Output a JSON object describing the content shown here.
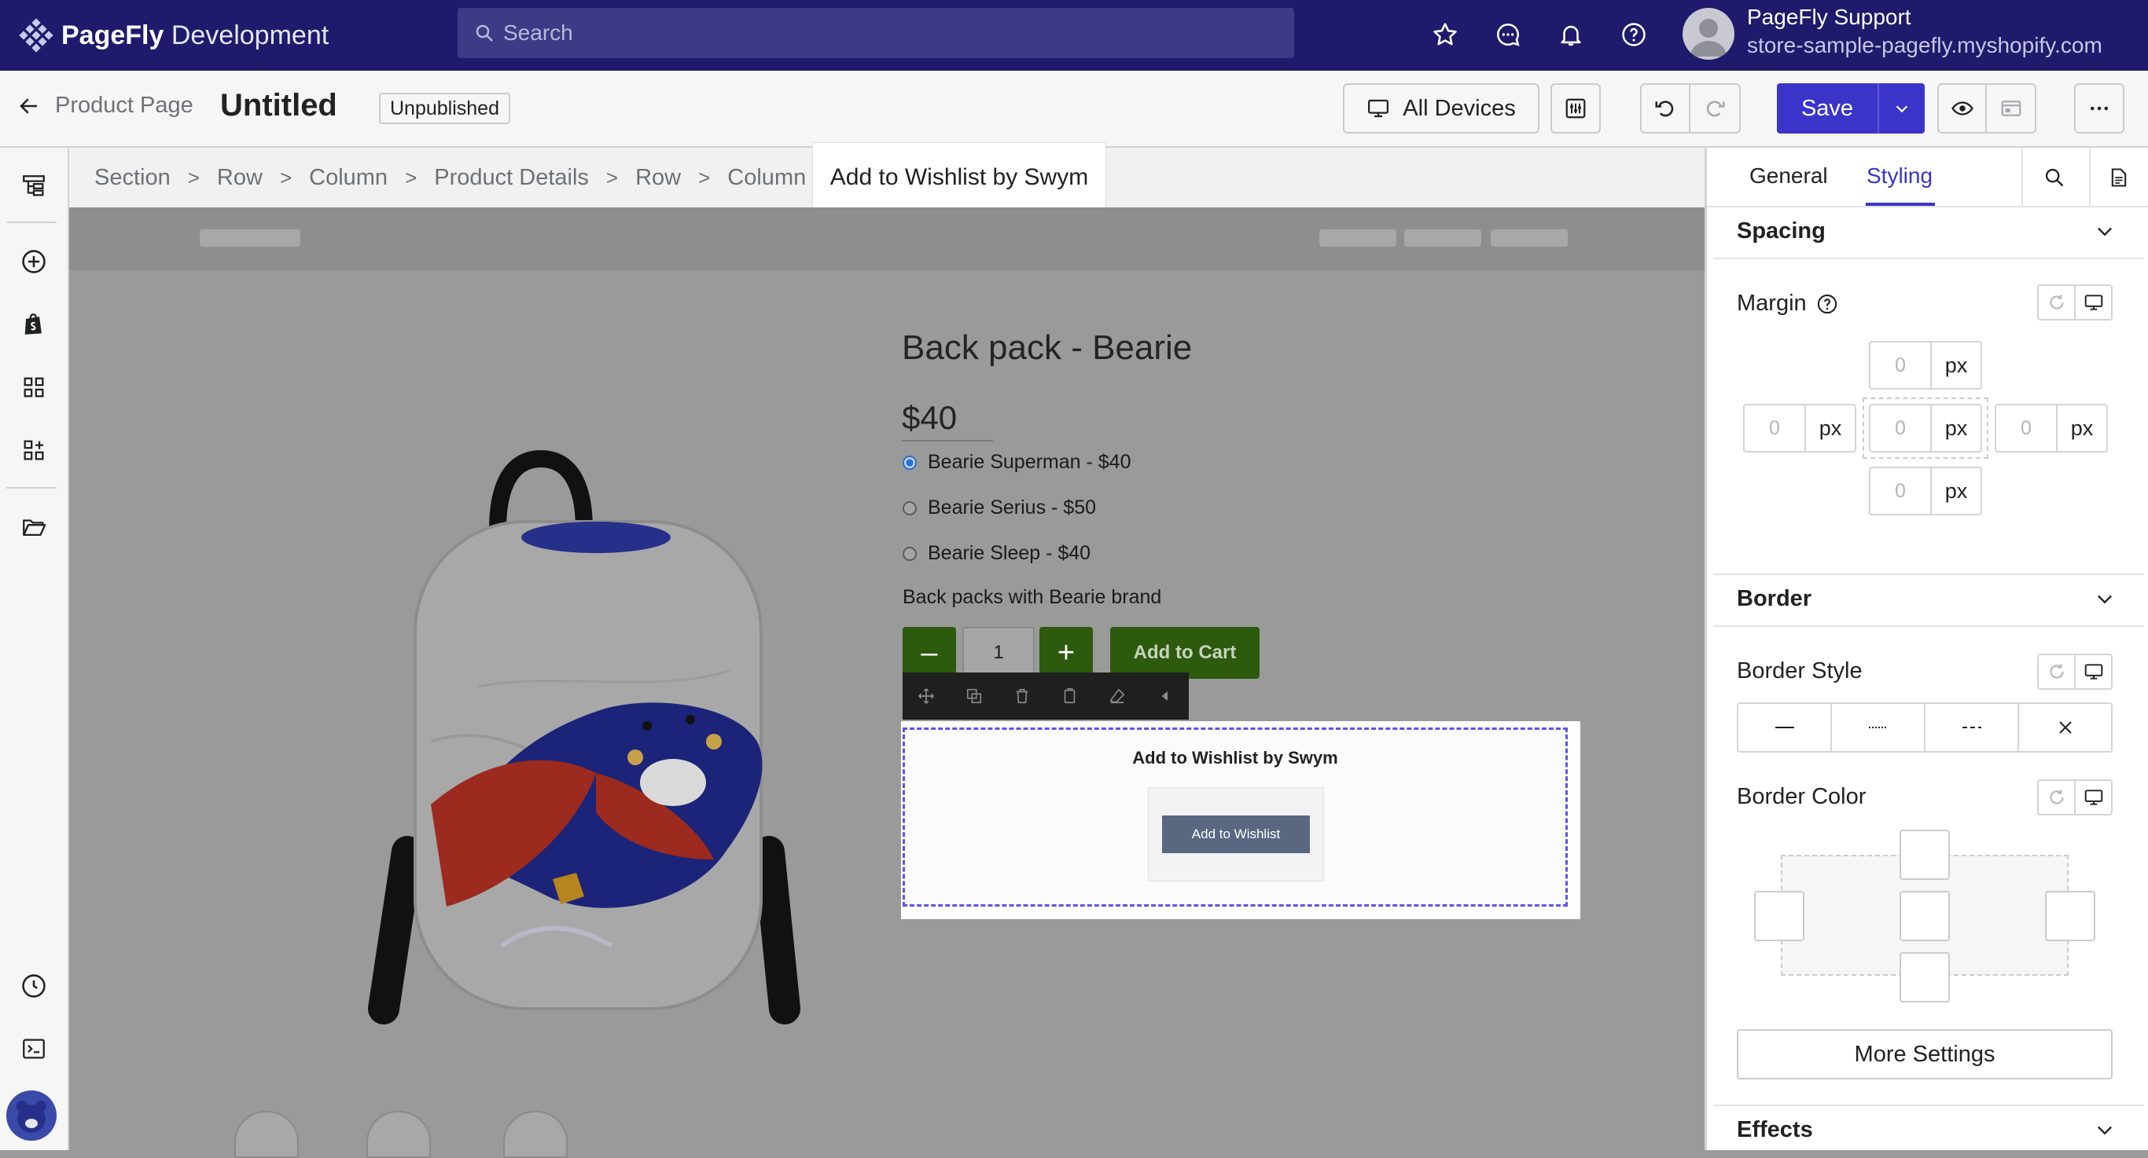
{
  "app": {
    "brand_bold": "PageFly",
    "brand_rest": "Development"
  },
  "search": {
    "placeholder": "Search"
  },
  "user": {
    "name": "PageFly Support",
    "store": "store-sample-pagefly.myshopify.com"
  },
  "header": {
    "back_label": "Product Page",
    "page_title": "Untitled",
    "status_badge": "Unpublished",
    "devices_label": "All Devices",
    "save_label": "Save"
  },
  "breadcrumb": {
    "items": [
      "Section",
      "Row",
      "Column",
      "Product Details",
      "Row",
      "Column"
    ],
    "active": "Add to Wishlist by Swym"
  },
  "product": {
    "title": "Back pack - Bearie",
    "price": "$40",
    "variants": [
      {
        "label": "Bearie Superman - $40",
        "selected": true
      },
      {
        "label": "Bearie Serius - $50",
        "selected": false
      },
      {
        "label": "Bearie Sleep - $40",
        "selected": false
      }
    ],
    "description": "Back packs with Bearie brand",
    "quantity": "1",
    "add_to_cart": "Add to Cart",
    "minus": "–",
    "plus": "+"
  },
  "wishlist": {
    "title": "Add to Wishlist by Swym",
    "button": "Add to Wishlist"
  },
  "panel": {
    "tabs": [
      "General",
      "Styling"
    ],
    "active_tab": "Styling",
    "spacing": {
      "heading": "Spacing",
      "margin_label": "Margin",
      "values": {
        "top": "0",
        "left": "0",
        "center": "0",
        "right": "0",
        "bottom": "0"
      },
      "unit": "px"
    },
    "border": {
      "heading": "Border",
      "style_label": "Border Style",
      "color_label": "Border Color"
    },
    "more_settings": "More Settings",
    "effects": {
      "heading": "Effects"
    }
  },
  "colors": {
    "topbar": "#1f1a6b",
    "accent": "#3b34c8",
    "cart_button": "#2d5a0d",
    "selection": "#5c55e8"
  }
}
